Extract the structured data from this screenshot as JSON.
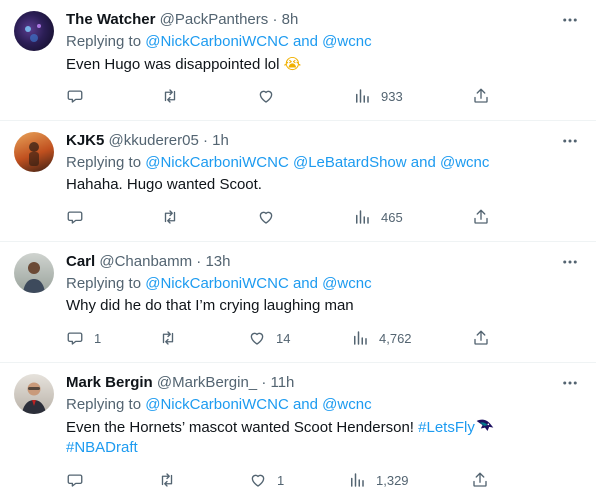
{
  "tweets": [
    {
      "name": "The Watcher",
      "handle": "@PackPanthers",
      "dot": "·",
      "time": "8h",
      "replying_prefix": "Replying to",
      "mentions": [
        "@NickCarboniWCNC",
        "and",
        "@wcnc"
      ],
      "text": "Even Hugo was disappointed lol",
      "emoji": "😭",
      "counts": {
        "reply": "",
        "retweet": "",
        "like": "",
        "views": "933"
      }
    },
    {
      "name": "KJK5",
      "handle": "@kkuderer05",
      "dot": "·",
      "time": "1h",
      "replying_prefix": "Replying to",
      "mentions": [
        "@NickCarboniWCNC",
        "@LeBatardShow",
        "and",
        "@wcnc"
      ],
      "text": "Hahaha. Hugo wanted Scoot.",
      "counts": {
        "reply": "",
        "retweet": "",
        "like": "",
        "views": "465"
      }
    },
    {
      "name": "Carl",
      "handle": "@Chanbamm",
      "dot": "·",
      "time": "13h",
      "replying_prefix": "Replying to",
      "mentions": [
        "@NickCarboniWCNC",
        "and",
        "@wcnc"
      ],
      "text": "Why did he do that I’m crying laughing man",
      "counts": {
        "reply": "1",
        "retweet": "",
        "like": "14",
        "views": "4,762"
      }
    },
    {
      "name": "Mark Bergin",
      "handle": "@MarkBergin_",
      "dot": "·",
      "time": "11h",
      "replying_prefix": "Replying to",
      "mentions": [
        "@NickCarboniWCNC",
        "and",
        "@wcnc"
      ],
      "text": "Even the Hornets’ mascot wanted Scoot Henderson!",
      "hashtags": [
        "#LetsFly",
        "#NBADraft"
      ],
      "counts": {
        "reply": "",
        "retweet": "",
        "like": "1",
        "views": "1,329"
      }
    }
  ],
  "icons": {
    "reply": "reply-icon",
    "retweet": "retweet-icon",
    "like": "heart-icon",
    "views": "views-icon",
    "share": "share-icon",
    "more": "more-icon",
    "hornets": "hornets-logo-icon"
  },
  "colors": {
    "text": "#0f1419",
    "secondary": "#536471",
    "link": "#1d9bf0",
    "divider": "#eff3f4"
  }
}
